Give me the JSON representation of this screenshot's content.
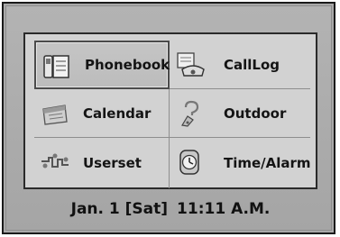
{
  "menu": {
    "items": [
      {
        "label": "Phonebook",
        "icon": "phonebook-icon",
        "selected": true
      },
      {
        "label": "CallLog",
        "icon": "calllog-icon",
        "selected": false
      },
      {
        "label": "Calendar",
        "icon": "calendar-icon",
        "selected": false
      },
      {
        "label": "Outdoor",
        "icon": "outdoor-icon",
        "selected": false
      },
      {
        "label": "Userset",
        "icon": "userset-icon",
        "selected": false
      },
      {
        "label": "Time/Alarm",
        "icon": "time-alarm-icon",
        "selected": false
      }
    ]
  },
  "status_bar": {
    "date": "Jan. 1 [Sat]",
    "time": "11:11 A.M."
  },
  "colors": {
    "bezel": "#a9a9a9",
    "screen": "#d2d2d2",
    "text": "#141414"
  }
}
